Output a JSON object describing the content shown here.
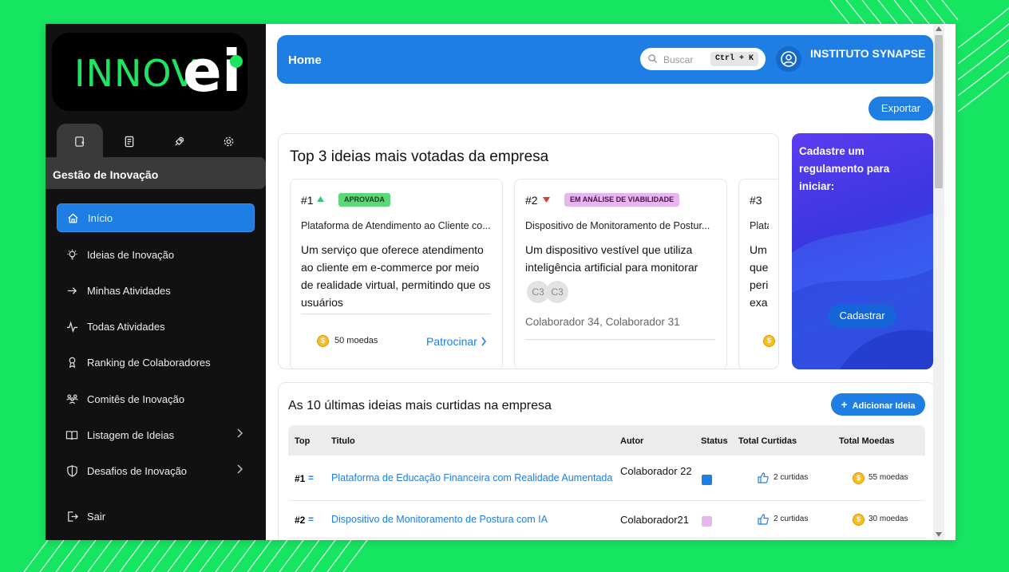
{
  "brand": {
    "logo_text": "INNOV",
    "logo_mark": "ei"
  },
  "sidebar": {
    "tabs": [
      {
        "icon": "bookmark-icon",
        "active": true
      },
      {
        "icon": "notebook-icon",
        "active": false
      },
      {
        "icon": "rocket-icon",
        "active": false
      },
      {
        "icon": "gear-icon",
        "active": false
      }
    ],
    "section_title": "Gestão de Inovação",
    "items": [
      {
        "label": "Início",
        "icon": "home-icon",
        "active": true
      },
      {
        "label": "Ideias de Inovação",
        "icon": "lightbulb-icon"
      },
      {
        "label": "Minhas Atividades",
        "icon": "arrow-right-icon"
      },
      {
        "label": "Todas Atividades",
        "icon": "activity-icon"
      },
      {
        "label": "Ranking de Colaboradores",
        "icon": "trophy-icon"
      },
      {
        "label": "Comitês de Inovação",
        "icon": "users-icon"
      },
      {
        "label": "Listagem de Ideias",
        "icon": "book-icon",
        "chevron": true
      },
      {
        "label": "Desafios de Inovação",
        "icon": "shield-icon",
        "chevron": true
      }
    ],
    "logout_label": "Sair"
  },
  "header": {
    "title": "Home",
    "search_placeholder": "Buscar",
    "search_shortcut": "Ctrl + K",
    "org_name": "INSTITUTO SYNAPSE"
  },
  "export_label": "Exportar",
  "top3": {
    "title": "Top 3 ideias mais votadas da empresa",
    "ideas": [
      {
        "rank": "#1",
        "trend": "up",
        "status": "APROVADA",
        "title": "Plataforma de Atendimento ao Cliente co...",
        "description": "Um serviço que oferece atendimento ao cliente em e-commerce por meio de realidade virtual, permitindo que os usuários",
        "coins": "50 moedas",
        "sponsor_label": "Patrocinar"
      },
      {
        "rank": "#2",
        "trend": "down",
        "status": "EM ANÁLISE DE VIABILIDADE",
        "title": "Dispositivo de Monitoramento de Postur...",
        "description": "Um dispositivo vestível que utiliza inteligência artificial para monitorar",
        "chips": [
          "C3",
          "C3"
        ],
        "authors": "Colaborador 34, Colaborador 31"
      },
      {
        "rank": "#3",
        "title": "Plata",
        "description": "Um que peri exa"
      }
    ]
  },
  "rule_card": {
    "text": "Cadastre um regulamento para iniciar:",
    "button_label": "Cadastrar"
  },
  "latest": {
    "title": "As 10 últimas ideias mais curtidas na empresa",
    "add_label": "Adicionar Ideia",
    "columns": [
      "Top",
      "Titulo",
      "Autor",
      "Status",
      "Total Curtidas",
      "Total Moedas"
    ],
    "rows": [
      {
        "rank": "#1",
        "trend": "=",
        "title": "Plataforma de Educação Financeira com Realidade Aumentada",
        "author": "Colaborador 22",
        "status_color": "#1e7ee4",
        "likes": "2 curtidas",
        "coins": "55 moedas"
      },
      {
        "rank": "#2",
        "trend": "=",
        "title": "Dispositivo de Monitoramento de Postura com IA",
        "author": "Colaborador21",
        "status_color": "#e8b6ee",
        "likes": "2 curtidas",
        "coins": "30 moedas"
      }
    ]
  }
}
